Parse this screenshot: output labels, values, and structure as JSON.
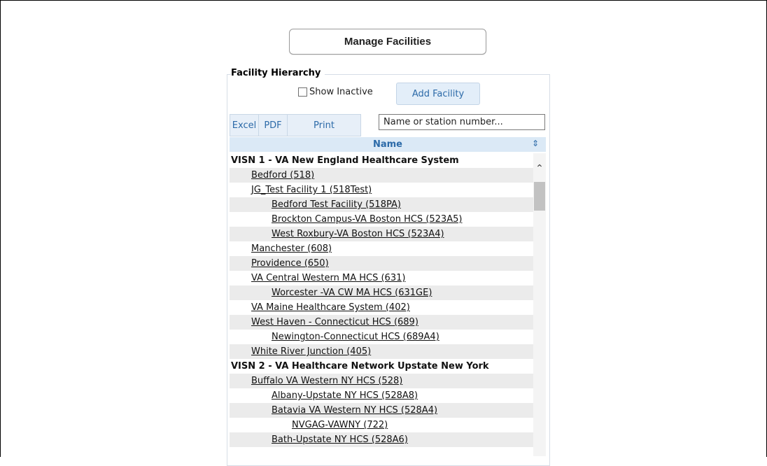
{
  "manage_button": "Manage Facilities",
  "panel_title": "Facility Hierarchy",
  "show_inactive_label": "Show Inactive",
  "add_facility_label": "Add Facility",
  "export": {
    "excel": "Excel",
    "pdf": "PDF",
    "print": "Print"
  },
  "search": {
    "placeholder": "Name or station number..."
  },
  "table": {
    "header": "Name",
    "rows": [
      {
        "label": "VISN 1 - VA New England Healthcare System",
        "level": 0
      },
      {
        "label": "Bedford (518)",
        "level": 1
      },
      {
        "label": "JG_Test Facility 1 (518Test)",
        "level": 1
      },
      {
        "label": "Bedford Test Facility (518PA)",
        "level": 2
      },
      {
        "label": "Brockton Campus-VA Boston HCS (523A5)",
        "level": 2
      },
      {
        "label": "West Roxbury-VA Boston HCS (523A4)",
        "level": 2
      },
      {
        "label": "Manchester (608)",
        "level": 1
      },
      {
        "label": "Providence (650)",
        "level": 1
      },
      {
        "label": "VA Central Western MA HCS (631)",
        "level": 1
      },
      {
        "label": "Worcester -VA CW MA HCS (631GE)",
        "level": 2
      },
      {
        "label": "VA Maine Healthcare System (402)",
        "level": 1
      },
      {
        "label": "West Haven - Connecticut HCS (689)",
        "level": 1
      },
      {
        "label": "Newington-Connecticut HCS (689A4)",
        "level": 2
      },
      {
        "label": "White River Junction (405)",
        "level": 1
      },
      {
        "label": "VISN 2 - VA Healthcare Network Upstate New York",
        "level": 0
      },
      {
        "label": "Buffalo VA Western NY HCS (528)",
        "level": 1
      },
      {
        "label": "Albany-Upstate NY HCS (528A8)",
        "level": 2
      },
      {
        "label": "Batavia VA Western NY HCS (528A4)",
        "level": 2
      },
      {
        "label": "NVGAG-VAWNY (722)",
        "level": 3
      },
      {
        "label": "Bath-Upstate NY HCS (528A6)",
        "level": 2
      }
    ]
  },
  "colors": {
    "accent": "#2c6aa8",
    "header_bg": "#dbe9f6",
    "row_alt": "#ebebeb"
  }
}
